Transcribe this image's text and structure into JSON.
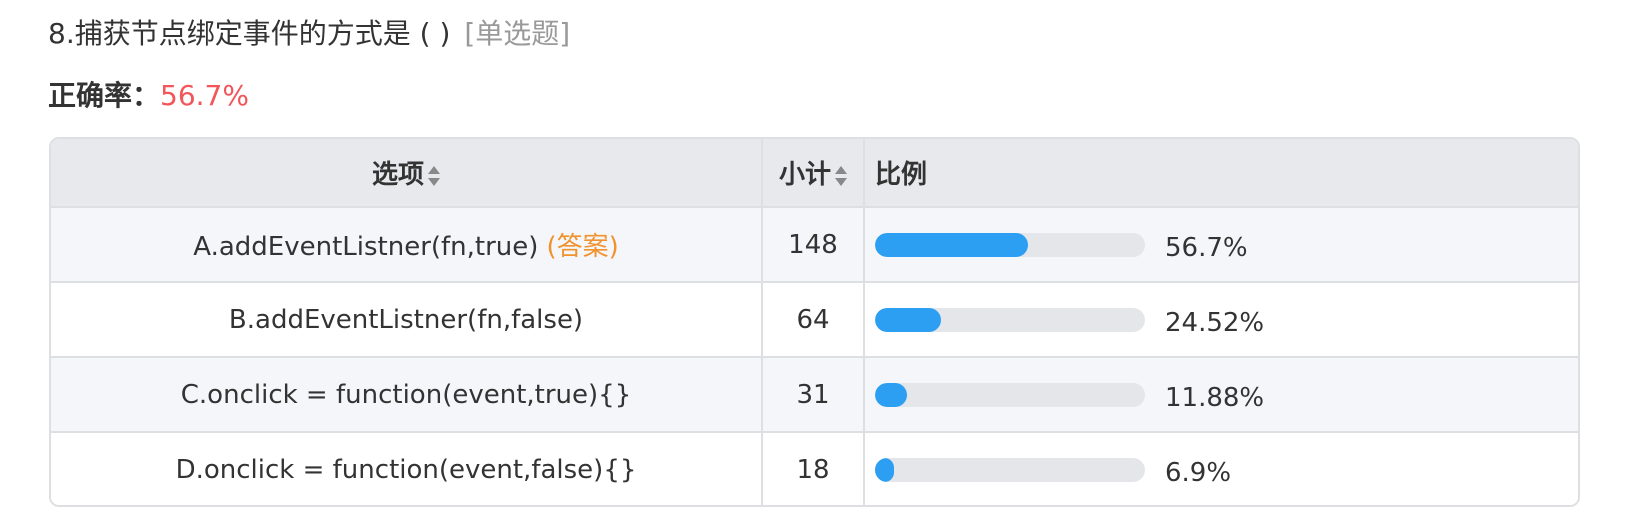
{
  "question": {
    "title": "8.捕获节点绑定事件的方式是 ( )",
    "type_label": "[单选题]"
  },
  "accuracy": {
    "label": "正确率：",
    "value": "56.7%"
  },
  "table": {
    "headers": {
      "option": "选项",
      "count": "小计",
      "ratio": "比例"
    },
    "rows": [
      {
        "option": "A.addEventListner(fn,true)",
        "answer_tag": "(答案)",
        "count": "148",
        "ratio": 0.567,
        "percent": "56.7%"
      },
      {
        "option": "B.addEventListner(fn,false)",
        "answer_tag": "",
        "count": "64",
        "ratio": 0.2452,
        "percent": "24.52%"
      },
      {
        "option": "C.onclick = function(event,true){}",
        "answer_tag": "",
        "count": "31",
        "ratio": 0.1188,
        "percent": "11.88%"
      },
      {
        "option": "D.onclick = function(event,false){}",
        "answer_tag": "",
        "count": "18",
        "ratio": 0.069,
        "percent": "6.9%"
      }
    ]
  },
  "colors": {
    "accuracy": "#f2555a",
    "answer_tag": "#f0922d",
    "bar_fill": "#2d9ff2",
    "bar_track": "#e5e6e9",
    "header_bg": "#e8e9ec"
  }
}
